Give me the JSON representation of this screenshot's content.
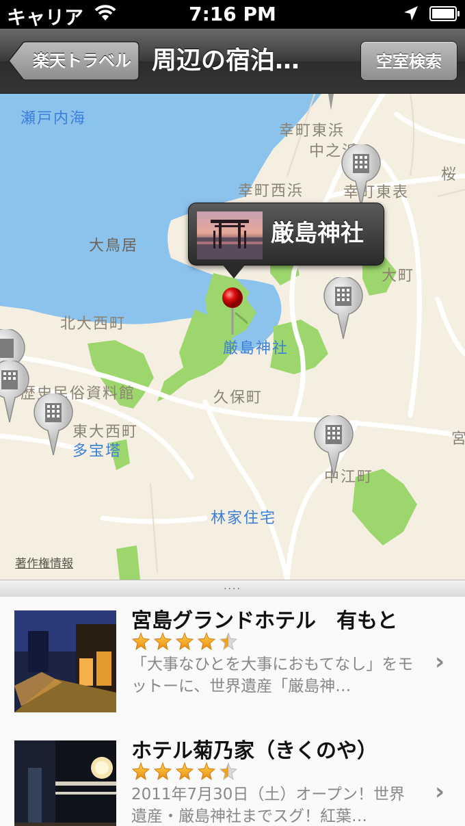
{
  "status_bar": {
    "carrier": "キャリア",
    "time": "7:16 PM",
    "battery_level": 0.9
  },
  "nav": {
    "back_label": "楽天トラベル",
    "title": "周辺の宿泊…",
    "right_button_label": "空室検索"
  },
  "map": {
    "labels": {
      "seto": "瀬戸内海",
      "saiwai_higashihama": "幸町東浜",
      "nakanohama": "中之浜",
      "saiwai_nishihama": "幸町西浜",
      "saiwai_higashiomote": "幸町東表",
      "sakura": "桜",
      "otorii": "大鳥居",
      "omachi": "大町",
      "kita_onishi": "北大西町",
      "itsukushima": "厳島神社",
      "rekishi": "歴史民俗資料館",
      "kubo": "久保町",
      "higashi_onishi": "東大西町",
      "tahoto": "多宝塔",
      "nakae": "中江町",
      "miya": "宮",
      "hayashi": "林家住宅"
    },
    "callout_title": "厳島神社",
    "copyright": "著作権情報"
  },
  "drawer_handle": "....",
  "hotels": [
    {
      "name": "宮島グランドホテル　有もと",
      "rating": 4.5,
      "description": "「大事なひとを大事におもてなし」をモットーに、世界遺産「厳島神…"
    },
    {
      "name": "ホテル菊乃家（きくのや）",
      "rating": 4.5,
      "description": "2011年7月30日（土）オープン！世界遺産・厳島神社までスグ！紅葉…"
    }
  ],
  "colors": {
    "water": "#8cc3ed",
    "land": "#f5efe2",
    "park": "#9ed66e",
    "poi_label": "#3b7fd6",
    "star": "#f0a21c"
  }
}
